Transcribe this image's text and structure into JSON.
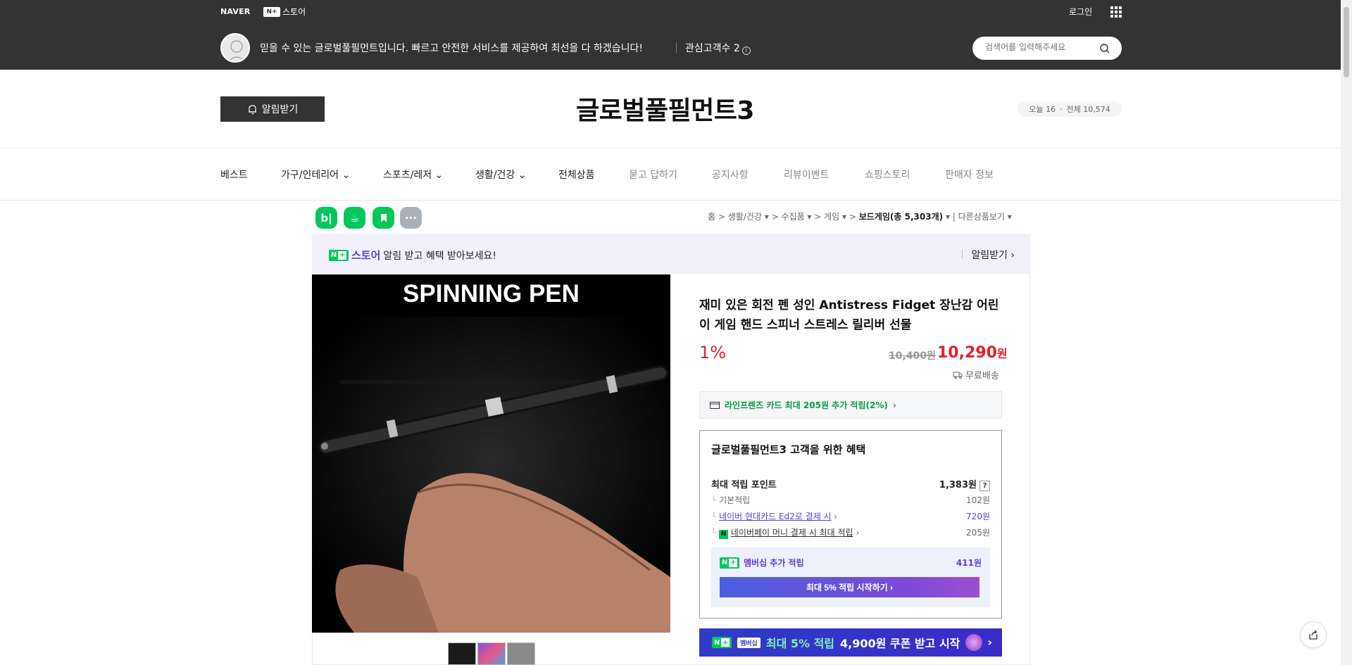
{
  "gnb": {
    "naver_logo": "NAVER",
    "nstore_label": "스토어",
    "nplus_mark": "N+",
    "login": "로그인"
  },
  "store": {
    "description": "믿을 수 있는 글로벌풀필먼트입니다. 빠르고 안전한 서비스를 제공하여 최선을 다 하겠습니다!",
    "fav_label": "관심고객수 2",
    "search_placeholder": "검색어를 입력해주세요",
    "alarm_button": "알림받기",
    "title": "글로벌풀필먼트3",
    "visit_today": "오늘 16",
    "visit_total": "전체 10,574"
  },
  "nav": {
    "items": [
      "베스트",
      "가구/인테리어",
      "스포츠/레저",
      "생활/건강",
      "전체상품",
      "묻고 답하기",
      "공지사항",
      "리뷰이벤트",
      "쇼핑스토리",
      "판매자 정보"
    ]
  },
  "share_icons": [
    "blog-icon",
    "cafe-icon",
    "talk-icon",
    "more-icon"
  ],
  "breadcrumb": {
    "home": "홈",
    "c1": "생활/건강",
    "c2": "수집품",
    "c3": "게임",
    "c4": "보드게임(총 5,303개)",
    "other": "다른상품보기"
  },
  "promo": {
    "store": "스토어",
    "text": "알림 받고 혜택 받아보세요!",
    "button": "알림받기"
  },
  "product": {
    "image_title": "SPINNING PEN",
    "title": "재미 있은 회전 펜 성인 Antistress Fidget 장난감 어린이 게임 핸드 스피너 스트레스 릴리버 선물",
    "discount": "1%",
    "original_price": "10,400원",
    "price": "10,290",
    "price_unit": "원",
    "shipping": "무료배송"
  },
  "card_promo": "라인프렌즈 카드 최대 205원 추가 적립(2%)",
  "benefit": {
    "title": "글로벌풀필먼트3 고객을 위한 혜택",
    "max_point_label": "최대 적립 포인트",
    "max_point_value": "1,383원",
    "rows": [
      {
        "label": "기본적립",
        "value": "102원"
      },
      {
        "label": "네이버 현대카드 Ed2로 결제 시",
        "value": "720원"
      },
      {
        "label": "네이버페이 머니 결제 시 최대 적립",
        "value": "205원"
      }
    ],
    "membership_label": "멤버십 추가 적립",
    "membership_value": "411원",
    "membership_button": "최대 5% 적립 시작하기"
  },
  "coupon": {
    "badge": "멤버십",
    "text_hl": "최대 5% 적립",
    "text": "4,900원 쿠폰 받고 시작"
  },
  "colors": {
    "accent_red": "#e1202b",
    "naver_green": "#03c75a",
    "purple": "#5f3fd3"
  }
}
